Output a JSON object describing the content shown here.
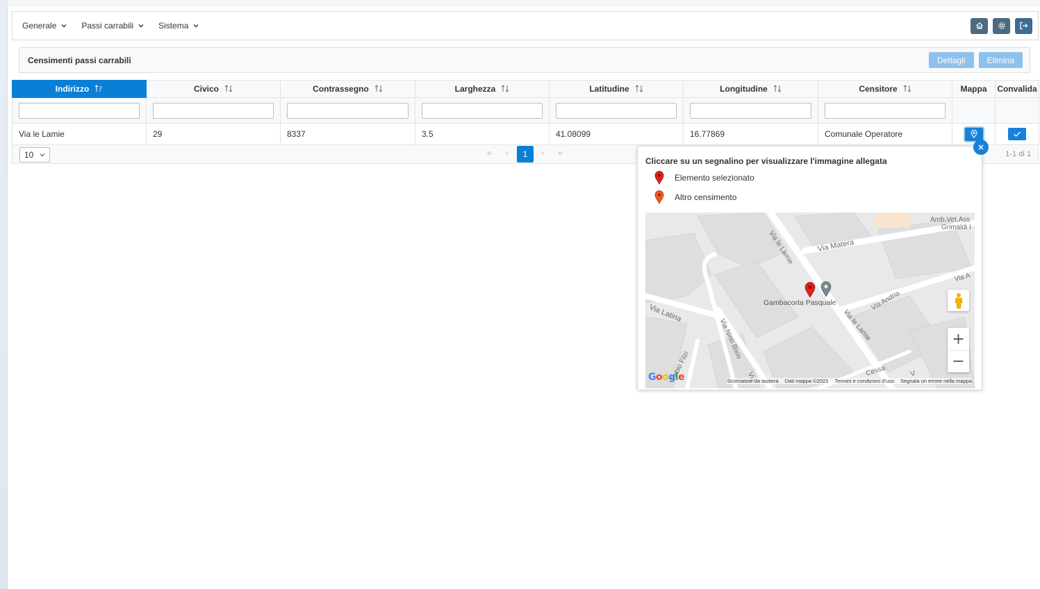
{
  "menu": {
    "items": [
      "Generale",
      "Passi carrabili",
      "Sistema"
    ]
  },
  "toolbar": {
    "icons": [
      "home-icon",
      "gear-icon",
      "logout-icon"
    ]
  },
  "panel": {
    "title": "Censimenti passi carrabili",
    "details_label": "Dettagli",
    "delete_label": "Elimina"
  },
  "table": {
    "columns": [
      "Indirizzo",
      "Civico",
      "Contrassegno",
      "Larghezza",
      "Latitudine",
      "Longitudine",
      "Censitore",
      "Mappa",
      "Convalida"
    ],
    "sorted_column": "Indirizzo",
    "rows": [
      {
        "indirizzo": "Via le Lamie",
        "civico": "29",
        "contrassegno": "8337",
        "larghezza": "3.5",
        "latitudine": "41.08099",
        "longitudine": "16.77869",
        "censitore": "Comunale Operatore"
      }
    ]
  },
  "pager": {
    "rows_per_page": "10",
    "current_page": "1",
    "info": "1-1 di 1",
    "first": "«",
    "prev": "‹",
    "next": "›",
    "last": "»"
  },
  "map_popup": {
    "hint": "Cliccare su un segnalino per visualizzare l'immagine allegata",
    "legend": [
      {
        "label": "Elemento selezionato",
        "color": "#d91a1a"
      },
      {
        "label": "Altro censimento",
        "color": "#e8541e"
      }
    ],
    "streets": {
      "s1": "Via le Lamie",
      "s2": "Via Matera",
      "s3": "Amb.Vet.Ass",
      "s4": "Grimaldi I",
      "s5": "Via A",
      "s6": "Via Andria",
      "s7": "Gambacorta Pasquale",
      "s8": "Via le Lamie",
      "s9": "Via Latina",
      "s10": "Via Nino Bixio",
      "s11": "Via",
      "s12": "Fabio Filzi",
      "s13": "Cessa",
      "s14": "V"
    },
    "zoom_in": "+",
    "zoom_out": "−",
    "google": "Google",
    "attribution": [
      "Scorciatoie da tastiera",
      "Dati mappa ©2021",
      "Termini e condizioni d'uso",
      "Segnala un errore nella mappa"
    ]
  }
}
